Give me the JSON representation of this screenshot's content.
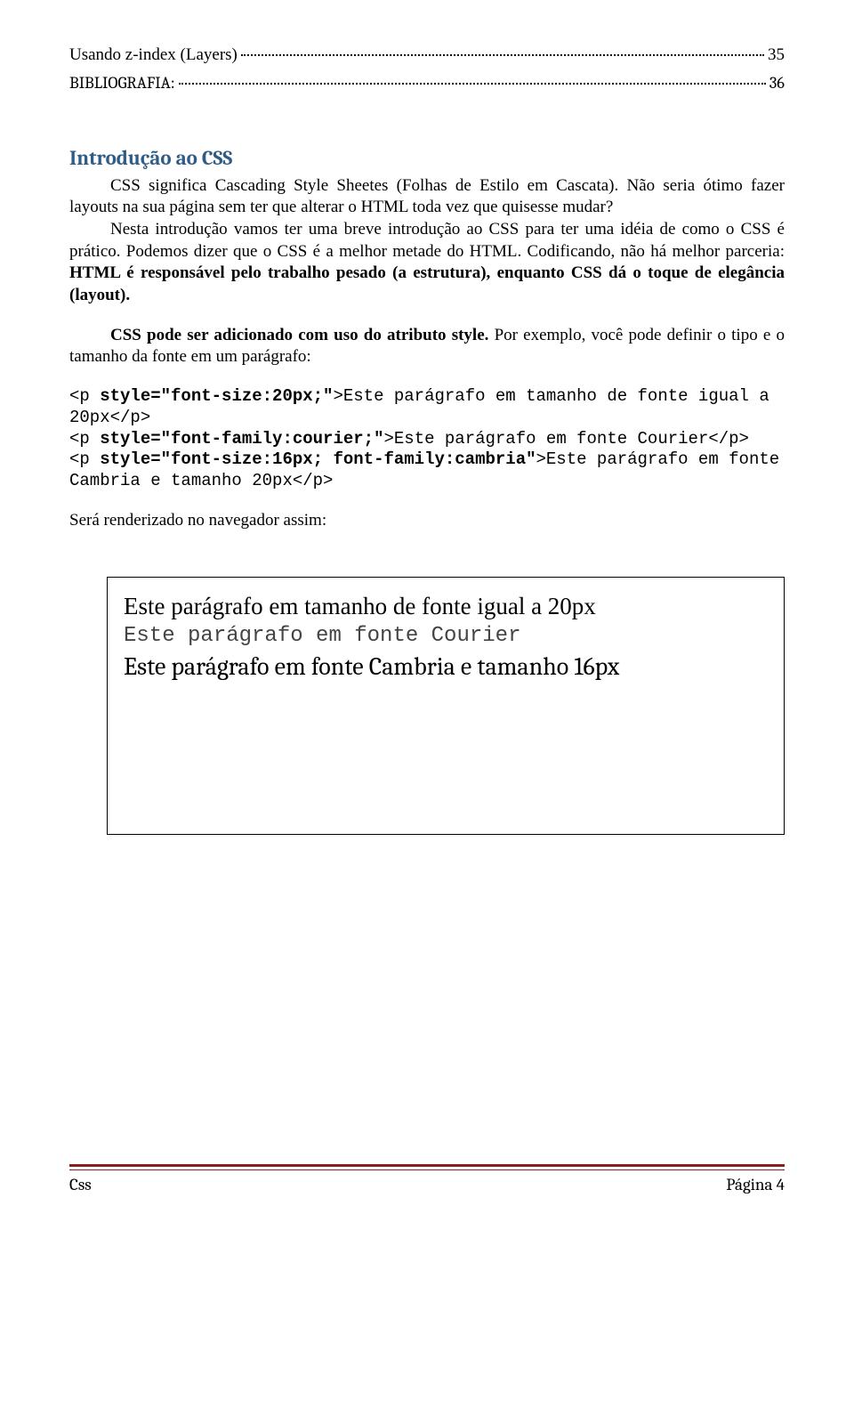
{
  "toc": {
    "item1_label": "Usando z-index (Layers)",
    "item1_page": "35",
    "item2_label": "BIBLIOGRAFIA:",
    "item2_page": "36"
  },
  "heading": "Introdução ao CSS",
  "p1_part1": "CSS significa Cascading Style Sheetes (Folhas de Estilo em Cascata). Não seria ótimo fazer layouts na sua página sem ter que alterar o HTML toda vez que quisesse mudar?",
  "p2_part1": "Nesta introdução vamos ter uma breve introdução ao CSS para ter uma idéia de como o CSS é prático. Podemos dizer que o CSS é a melhor metade do HTML. Codificando, não há melhor parceria: ",
  "p2_bold": "HTML é responsável pelo trabalho pesado (a estrutura), enquanto CSS dá o toque de elegância (layout).",
  "p3_bold": "CSS pode ser adicionado com uso do atributo style. ",
  "p3_rest": "Por exemplo, você pode definir o tipo e o tamanho da fonte em um parágrafo:",
  "code": {
    "l1a": "<p ",
    "l1b": "style=\"font-size:20px;\"",
    "l1c": ">Este parágrafo em tamanho de fonte igual a 20px</p>",
    "l2a": "<p ",
    "l2b": "style=\"font-family:courier;\"",
    "l2c": ">Este parágrafo em fonte Courier</p>",
    "l3a": "<p ",
    "l3b": "style=\"font-size:16px; font-family:cambria\"",
    "l3c": ">Este parágrafo em fonte Cambria e tamanho 20px</p>"
  },
  "p4": "Será renderizado no navegador assim:",
  "render": {
    "l1": "Este parágrafo em tamanho de fonte igual a 20px",
    "l2": "Este parágrafo em fonte Courier",
    "l3": "Este parágrafo em fonte Cambria e tamanho 16px"
  },
  "footer": {
    "left": "Css",
    "right": "Página 4"
  }
}
